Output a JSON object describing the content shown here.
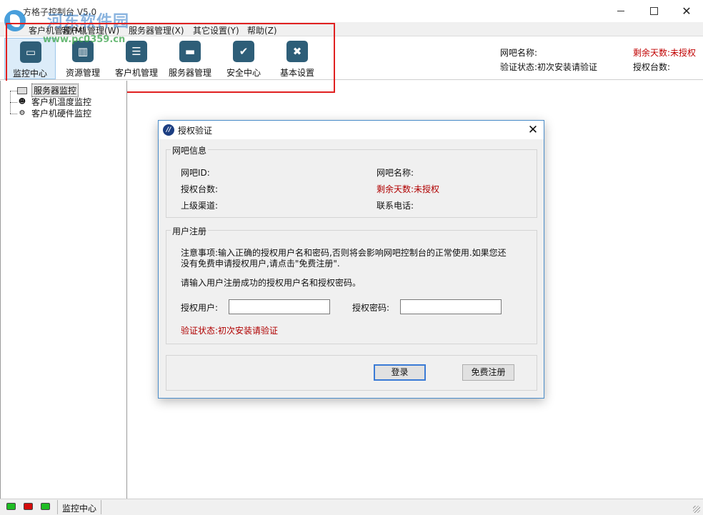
{
  "window": {
    "title": "方格子控制台 V5.0",
    "minimize": "",
    "maximize": "",
    "close": "✕"
  },
  "watermark": {
    "text": "河东软件园",
    "url": "www.pc0359.cn"
  },
  "menu": [
    "客户机管理(M)",
    "客户机管理(W)",
    "服务器管理(X)",
    "其它设置(Y)",
    "帮助(Z)"
  ],
  "toolbar": [
    {
      "label": "监控中心",
      "icon": "monitor-icon",
      "glyph": "▭",
      "active": true
    },
    {
      "label": "资源管理",
      "icon": "resource-icon",
      "glyph": "▥",
      "active": false
    },
    {
      "label": "客户机管理",
      "icon": "client-icon",
      "glyph": "☰",
      "active": false
    },
    {
      "label": "服务器管理",
      "icon": "server-icon",
      "glyph": "▬",
      "active": false
    },
    {
      "label": "安全中心",
      "icon": "shield-icon",
      "glyph": "✔",
      "active": false
    },
    {
      "label": "基本设置",
      "icon": "tools-icon",
      "glyph": "✖",
      "active": false
    }
  ],
  "header_info": {
    "cafe_name_label": "网吧名称:",
    "verify_status": "验证状态:初次安装请验证",
    "remaining_days": "剩余天数:未授权",
    "auth_count_label": "授权台数:"
  },
  "tree": [
    {
      "label": "服务器监控",
      "icon": "monitor-icon",
      "selected": true
    },
    {
      "label": "客户机温度监控",
      "icon": "user-icon",
      "selected": false
    },
    {
      "label": "客户机硬件监控",
      "icon": "gear-icon",
      "selected": false
    }
  ],
  "status": {
    "leds": [
      "green",
      "red",
      "green"
    ],
    "text": "监控中心"
  },
  "dialog": {
    "title": "授权验证",
    "close": "✕",
    "cafe_info": {
      "title": "网吧信息",
      "cafe_id": "网吧ID:",
      "cafe_name": "网吧名称:",
      "auth_count": "授权台数:",
      "remaining_days": "剩余天数:未授权",
      "channel": "上级渠道:",
      "phone": "联系电话:"
    },
    "register": {
      "title": "用户注册",
      "notice_line1": "注意事项:输入正确的授权用户名和密码,否则将会影响网吧控制台的正常使用.如果您还",
      "notice_line2": "没有免费申请授权用户,请点击\"免费注册\".",
      "instruction": "请输入用户注册成功的授权用户名和授权密码。",
      "user_label": "授权用户:",
      "user_value": "",
      "password_label": "授权密码:",
      "password_value": "",
      "verify_status": "验证状态:初次安装请验证"
    },
    "login_button": "登录",
    "register_button": "免费注册"
  }
}
